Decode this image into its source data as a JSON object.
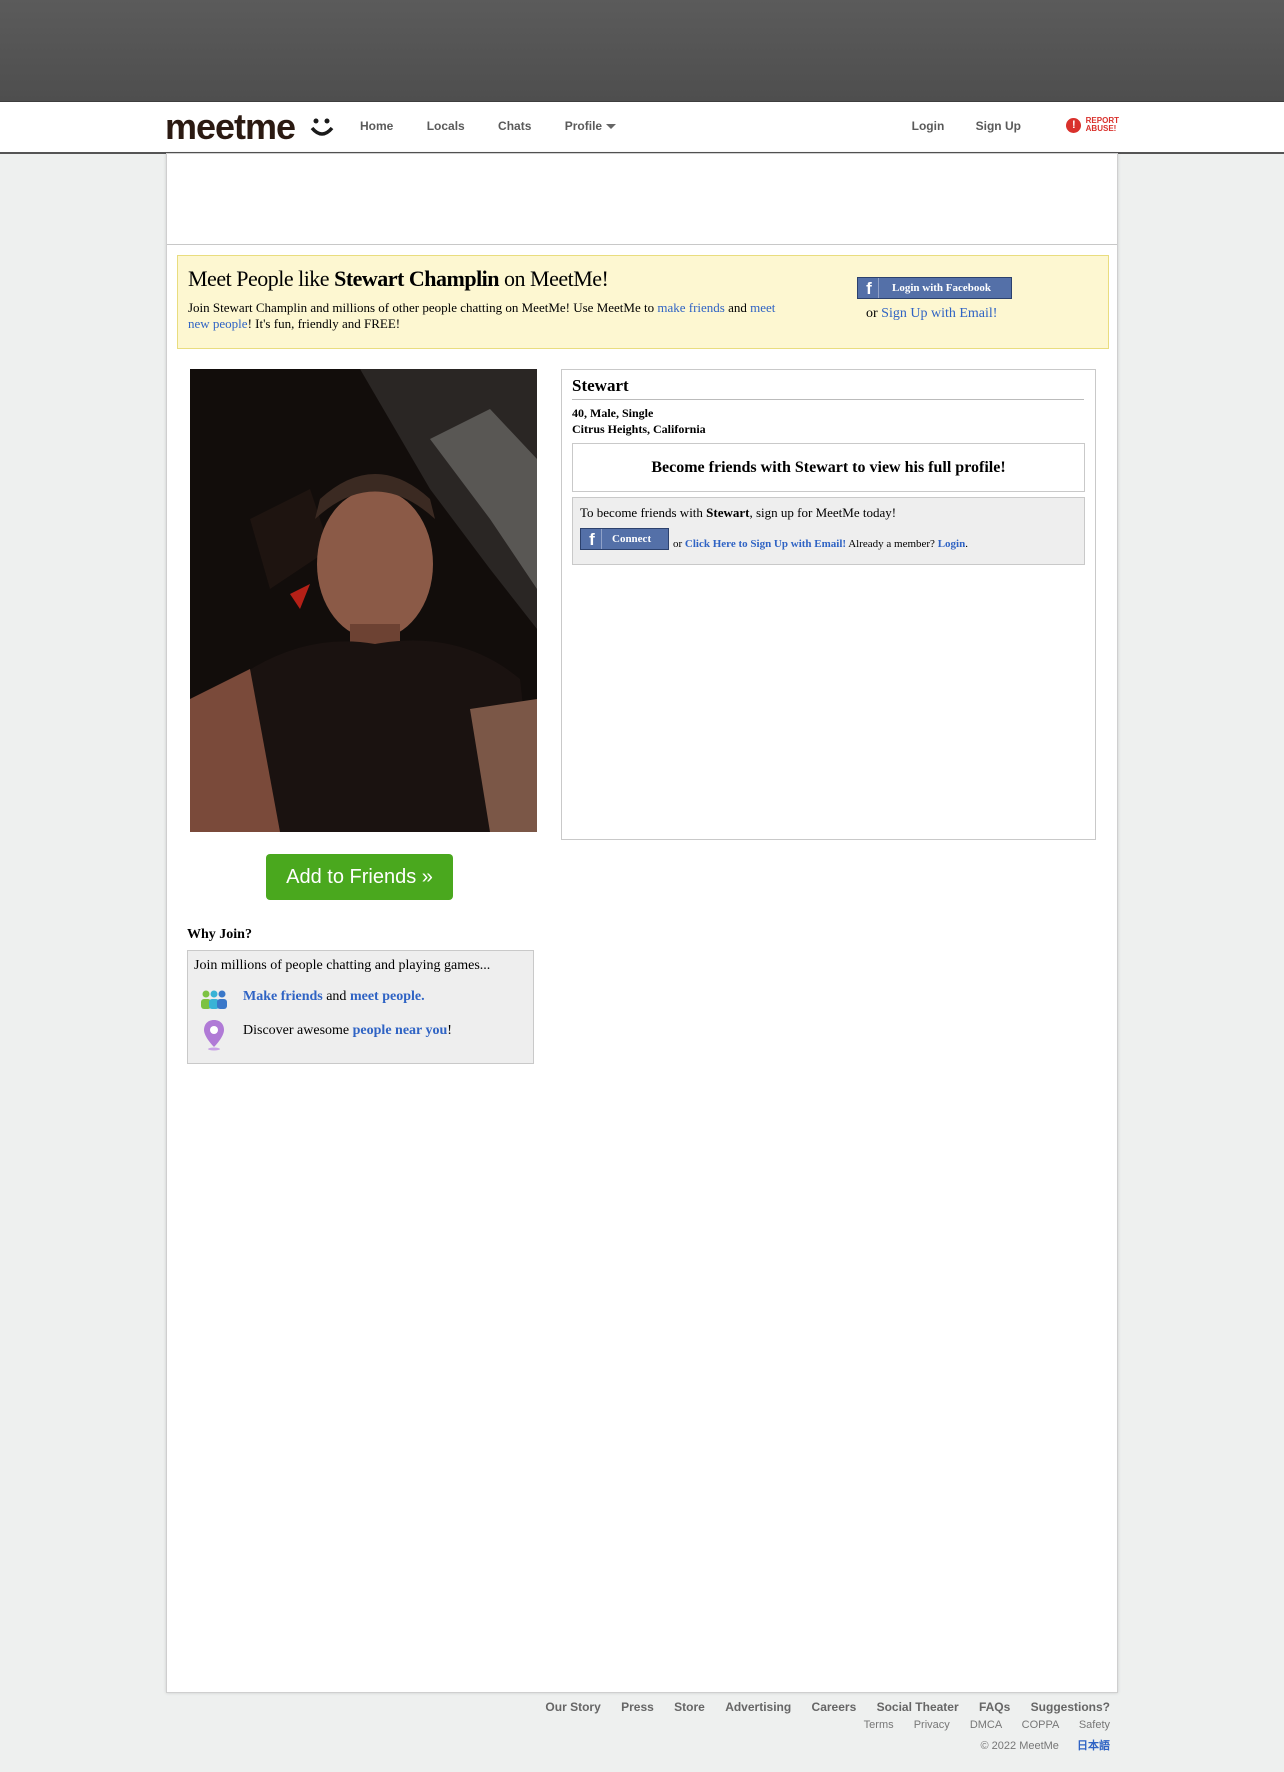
{
  "nav": {
    "logo": "meetme",
    "links": [
      "Home",
      "Locals",
      "Chats",
      "Profile"
    ],
    "login": "Login",
    "signup": "Sign Up",
    "report_line1": "REPORT",
    "report_line2": "ABUSE!"
  },
  "promo": {
    "title_prefix": "Meet People like ",
    "title_name": "Stewart Champlin",
    "title_suffix": " on MeetMe!",
    "desc_part1": "Join Stewart Champlin and millions of other people chatting on MeetMe! Use MeetMe to ",
    "desc_link1": "make friends",
    "desc_part2": " and ",
    "desc_link2": "meet new people",
    "desc_part3": "! It's fun, friendly and FREE!",
    "fb_login": "Login with Facebook",
    "or": "or ",
    "email_signup": "Sign Up with Email!"
  },
  "left": {
    "add_friends": "Add to Friends »",
    "why_join": "Why Join?",
    "why_intro": "Join millions of people chatting and playing games...",
    "row1_link1": "Make friends",
    "row1_mid": " and ",
    "row1_link2": "meet people.",
    "row2_text": "Discover awesome ",
    "row2_link": "people near you",
    "row2_end": "!"
  },
  "profile": {
    "name": "Stewart",
    "stats_line1": "40, Male, Single",
    "stats_line2": "Citrus Heights, California",
    "become": "Become friends with Stewart to view his full profile!",
    "signup_pre": "To become friends with ",
    "signup_name": "Stewart",
    "signup_post": ", sign up for MeetMe today!",
    "connect": "Connect",
    "or": "or ",
    "email_link": "Click Here to Sign Up with Email!",
    "member": " Already a member? ",
    "login_link": "Login",
    "period": "."
  },
  "footer": {
    "row1": [
      "Our Story",
      "Press",
      "Store",
      "Advertising",
      "Careers",
      "Social Theater",
      "FAQs",
      "Suggestions?"
    ],
    "row2": [
      "Terms",
      "Privacy",
      "DMCA",
      "COPPA",
      "Safety"
    ],
    "copyright": "© 2022 MeetMe",
    "language": "日本語"
  },
  "colors": {
    "accent": "#2f63c4",
    "green_button": "#4aa81e",
    "facebook": "#5470a8",
    "promo_bg": "#fdf7d1",
    "report": "#d9312c"
  }
}
